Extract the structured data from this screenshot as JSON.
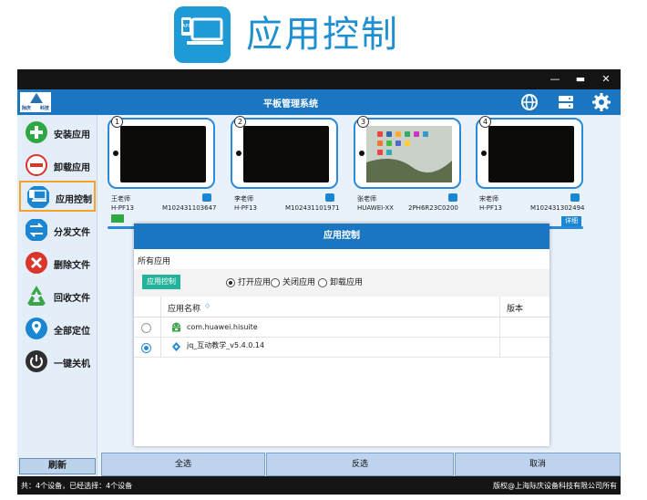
{
  "banner": {
    "title": "应用控制",
    "icon": "tablet-app-icon"
  },
  "window": {
    "title": "平板管理系统",
    "controls": [
      "minimize",
      "maximize",
      "close"
    ],
    "header_icons": [
      "globe-icon",
      "server-icon",
      "gear-icon"
    ]
  },
  "sidebar": {
    "items": [
      {
        "label": "安装应用",
        "icon": "plus-icon",
        "color": "#2fa844"
      },
      {
        "label": "卸载应用",
        "icon": "minus-icon",
        "color": "#d9352b"
      },
      {
        "label": "应用控制",
        "icon": "tablet-icon",
        "color": "#1b86d1",
        "active": true
      },
      {
        "label": "分发文件",
        "icon": "swap-icon",
        "color": "#1b86d1"
      },
      {
        "label": "删除文件",
        "icon": "close-icon",
        "color": "#d9352b"
      },
      {
        "label": "回收文件",
        "icon": "recycle-icon",
        "color": "#3aa64a"
      },
      {
        "label": "全部定位",
        "icon": "location-icon",
        "color": "#1b86d1"
      },
      {
        "label": "一键关机",
        "icon": "power-icon",
        "color": "#2f2f2f"
      }
    ],
    "refresh_label": "刷新"
  },
  "devices": [
    {
      "number": "1",
      "user": "王老师",
      "model": "H-PF13",
      "serial": "M102431103647"
    },
    {
      "number": "2",
      "user": "李老师",
      "model": "H-PF13",
      "serial": "M102431101971"
    },
    {
      "number": "3",
      "user": "张老师",
      "model": "HUAWEI-XX",
      "serial": "2PH6R23C0200"
    },
    {
      "number": "4",
      "user": "宋老师",
      "model": "H-PF13",
      "serial": "M102431302494"
    }
  ],
  "detail_label": "详细",
  "dialog": {
    "title": "应用控制",
    "section_label": "所有应用",
    "tag_label": "应用控制",
    "radios": [
      {
        "label": "打开应用",
        "checked": true
      },
      {
        "label": "关闭应用",
        "checked": false
      },
      {
        "label": "卸载应用",
        "checked": false
      }
    ],
    "columns": {
      "name": "应用名称",
      "version": "版本"
    },
    "rows": [
      {
        "name": "com.huawei.hisuite",
        "icon": "android-icon",
        "selected": false
      },
      {
        "name": "jq_互动教学_v5.4.0.14",
        "icon": "app-logo-icon",
        "selected": true
      }
    ]
  },
  "buttons": {
    "select_all": "全选",
    "invert": "反选",
    "cancel": "取消"
  },
  "status": {
    "left": "共：4个设备，已经选择：4个设备",
    "right": "版权@上海际庆设备科技有限公司所有"
  }
}
